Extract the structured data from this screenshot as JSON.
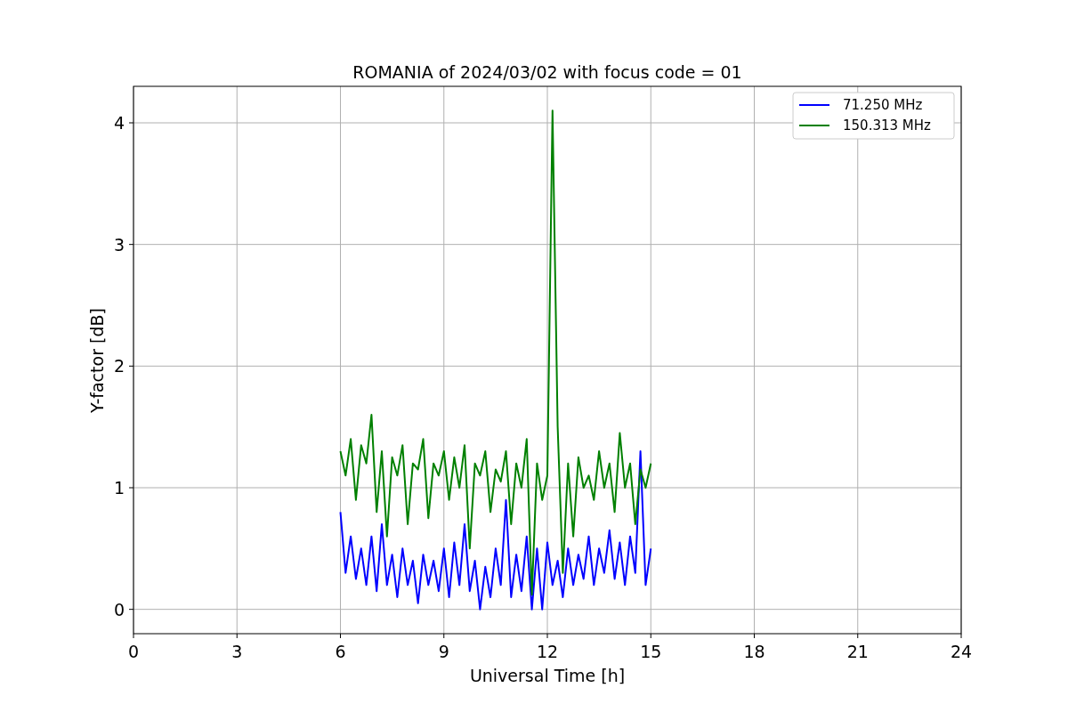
{
  "figure": {
    "chart_data": {
      "type": "line",
      "grid": true,
      "legend": "upper right",
      "title": "ROMANIA of 2024/03/02 with focus code = 01",
      "xlabel": "Universal Time [h]",
      "ylabel": "Y-factor [dB]",
      "xlim": [
        0,
        24
      ],
      "ylim": [
        -0.2,
        4.3
      ],
      "xticks": [
        0,
        3,
        6,
        9,
        12,
        15,
        18,
        21,
        24
      ],
      "yticks": [
        0,
        1,
        2,
        3,
        4
      ],
      "x": [
        6,
        6.15,
        6.3,
        6.45,
        6.6,
        6.75,
        6.9,
        7.05,
        7.2,
        7.35,
        7.5,
        7.65,
        7.8,
        7.95,
        8.1,
        8.25,
        8.4,
        8.55,
        8.7,
        8.85,
        9,
        9.15,
        9.3,
        9.45,
        9.6,
        9.75,
        9.9,
        10.05,
        10.2,
        10.35,
        10.5,
        10.65,
        10.8,
        10.95,
        11.1,
        11.25,
        11.4,
        11.55,
        11.7,
        11.85,
        12,
        12.15,
        12.3,
        12.45,
        12.6,
        12.75,
        12.9,
        13.05,
        13.2,
        13.35,
        13.5,
        13.65,
        13.8,
        13.95,
        14.1,
        14.25,
        14.4,
        14.55,
        14.7,
        14.85,
        15
      ],
      "series": [
        {
          "name": "71.250 MHz",
          "color": "#0000ff",
          "values": [
            0.8,
            0.3,
            0.6,
            0.25,
            0.5,
            0.2,
            0.6,
            0.15,
            0.7,
            0.2,
            0.45,
            0.1,
            0.5,
            0.2,
            0.4,
            0.05,
            0.45,
            0.2,
            0.4,
            0.15,
            0.5,
            0.1,
            0.55,
            0.2,
            0.7,
            0.15,
            0.4,
            0.0,
            0.35,
            0.1,
            0.5,
            0.2,
            0.9,
            0.1,
            0.45,
            0.15,
            0.6,
            0.0,
            0.5,
            0.0,
            0.55,
            0.2,
            0.4,
            0.1,
            0.5,
            0.2,
            0.45,
            0.25,
            0.6,
            0.2,
            0.5,
            0.3,
            0.65,
            0.25,
            0.55,
            0.2,
            0.6,
            0.3,
            1.3,
            0.2,
            0.5
          ]
        },
        {
          "name": "150.313 MHz",
          "color": "#008000",
          "values": [
            1.3,
            1.1,
            1.4,
            0.9,
            1.35,
            1.2,
            1.6,
            0.8,
            1.3,
            0.6,
            1.25,
            1.1,
            1.35,
            0.7,
            1.2,
            1.15,
            1.4,
            0.75,
            1.2,
            1.1,
            1.3,
            0.9,
            1.25,
            1.0,
            1.35,
            0.5,
            1.2,
            1.1,
            1.3,
            0.8,
            1.15,
            1.05,
            1.3,
            0.7,
            1.2,
            1.0,
            1.4,
            0.12,
            1.2,
            0.9,
            1.1,
            4.1,
            1.5,
            0.3,
            1.2,
            0.6,
            1.25,
            1.0,
            1.1,
            0.9,
            1.3,
            1.0,
            1.2,
            0.8,
            1.45,
            1.0,
            1.2,
            0.7,
            1.15,
            1.0,
            1.2
          ]
        }
      ]
    }
  }
}
